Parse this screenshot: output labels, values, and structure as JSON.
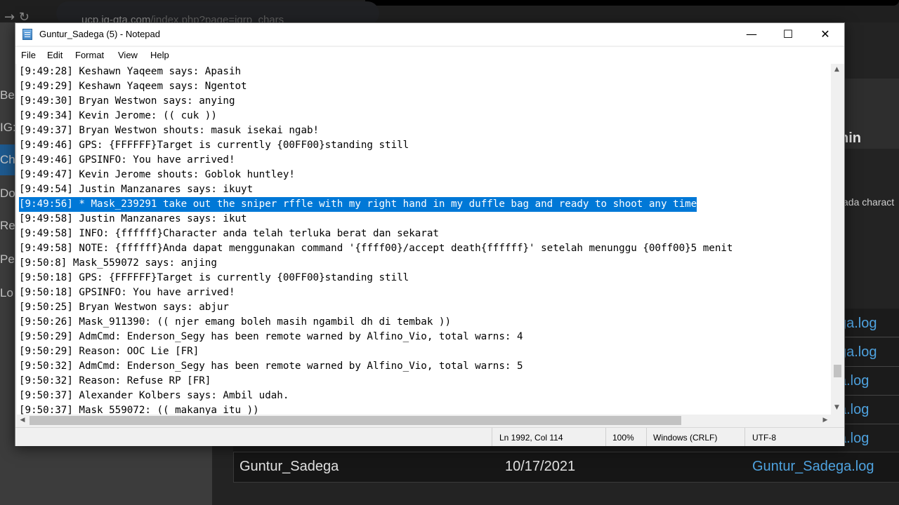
{
  "background": {
    "url_host": "ucp.jg-gta.com",
    "url_path": "/index.php?page=igrp_chars",
    "sidebar_items": [
      "Be",
      "IG:",
      "Ch",
      "Do",
      "Re",
      "Pe",
      "Lo"
    ],
    "header_fragment": "nin",
    "note_fragment": "ada charact",
    "log_cells": [
      "ga.log",
      "ga.log",
      "a.log",
      "a.log",
      "a.log"
    ],
    "last_row": {
      "name": "Guntur_Sadega",
      "date": "10/17/2021",
      "file": "Guntur_Sadega.log"
    }
  },
  "window": {
    "title": "Guntur_Sadega (5) - Notepad",
    "minimize_glyph": "—",
    "maximize_glyph": "☐",
    "close_glyph": "✕"
  },
  "menu": [
    "File",
    "Edit",
    "Format",
    "View",
    "Help"
  ],
  "editor": {
    "selected_line_index": 9,
    "lines": [
      "[9:49:28] Keshawn Yaqeem says: Apasih",
      "[9:49:29] Keshawn Yaqeem says: Ngentot",
      "[9:49:30] Bryan Westwon says: anying",
      "[9:49:34] Kevin Jerome: (( cuk ))",
      "[9:49:37] Bryan Westwon shouts: masuk isekai ngab!",
      "[9:49:46] GPS: {FFFFFF}Target is currently {00FF00}standing still",
      "[9:49:46] GPSINFO: You have arrived!",
      "[9:49:47] Kevin Jerome shouts: Goblok huntley!",
      "[9:49:54] Justin Manzanares says: ikuyt",
      "[9:49:56] * Mask_239291 take out the sniper rffle with my right hand in my duffle bag and ready to shoot any time",
      "[9:49:58] Justin Manzanares says: ikut",
      "[9:49:58] INFO: {ffffff}Character anda telah terluka berat dan sekarat",
      "[9:49:58] NOTE: {ffffff}Anda dapat menggunakan command '{ffff00}/accept death{ffffff}' setelah menunggu {00ff00}5 menit",
      "[9:50:8] Mask_559072 says: anjing",
      "[9:50:18] GPS: {FFFFFF}Target is currently {00FF00}standing still",
      "[9:50:18] GPSINFO: You have arrived!",
      "[9:50:25] Bryan Westwon says: abjur",
      "[9:50:26] Mask_911390: (( njer emang boleh masih ngambil dh di tembak ))",
      "[9:50:29] AdmCmd: Enderson_Segy has been remote warned by Alfino_Vio, total warns: 4",
      "[9:50:29] Reason: OOC Lie [FR]",
      "[9:50:32] AdmCmd: Enderson_Segy has been remote warned by Alfino_Vio, total warns: 5",
      "[9:50:32] Reason: Refuse RP [FR]",
      "[9:50:37] Alexander Kolbers says: Ambil udah.",
      "[9:50:37] Mask_559072: (( makanya itu ))"
    ]
  },
  "status": {
    "position": "Ln 1992, Col 114",
    "zoom": "100%",
    "line_ending": "Windows (CRLF)",
    "encoding": "UTF-8"
  }
}
